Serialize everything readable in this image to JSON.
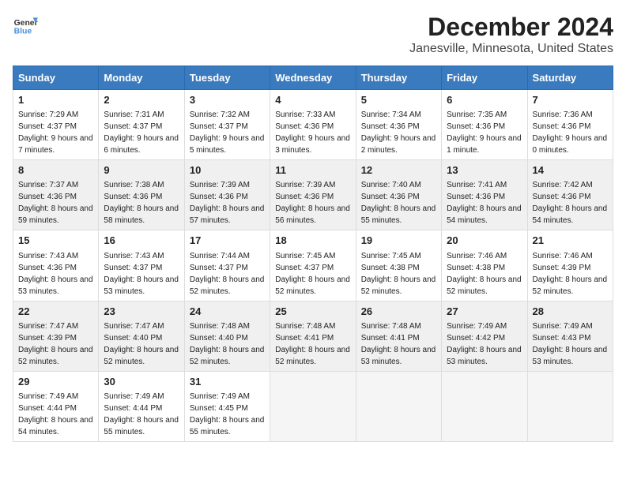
{
  "header": {
    "logo_general": "General",
    "logo_blue": "Blue",
    "title": "December 2024",
    "subtitle": "Janesville, Minnesota, United States"
  },
  "days_of_week": [
    "Sunday",
    "Monday",
    "Tuesday",
    "Wednesday",
    "Thursday",
    "Friday",
    "Saturday"
  ],
  "weeks": [
    [
      {
        "day": 1,
        "sunrise": "Sunrise: 7:29 AM",
        "sunset": "Sunset: 4:37 PM",
        "daylight": "Daylight: 9 hours and 7 minutes."
      },
      {
        "day": 2,
        "sunrise": "Sunrise: 7:31 AM",
        "sunset": "Sunset: 4:37 PM",
        "daylight": "Daylight: 9 hours and 6 minutes."
      },
      {
        "day": 3,
        "sunrise": "Sunrise: 7:32 AM",
        "sunset": "Sunset: 4:37 PM",
        "daylight": "Daylight: 9 hours and 5 minutes."
      },
      {
        "day": 4,
        "sunrise": "Sunrise: 7:33 AM",
        "sunset": "Sunset: 4:36 PM",
        "daylight": "Daylight: 9 hours and 3 minutes."
      },
      {
        "day": 5,
        "sunrise": "Sunrise: 7:34 AM",
        "sunset": "Sunset: 4:36 PM",
        "daylight": "Daylight: 9 hours and 2 minutes."
      },
      {
        "day": 6,
        "sunrise": "Sunrise: 7:35 AM",
        "sunset": "Sunset: 4:36 PM",
        "daylight": "Daylight: 9 hours and 1 minute."
      },
      {
        "day": 7,
        "sunrise": "Sunrise: 7:36 AM",
        "sunset": "Sunset: 4:36 PM",
        "daylight": "Daylight: 9 hours and 0 minutes."
      }
    ],
    [
      {
        "day": 8,
        "sunrise": "Sunrise: 7:37 AM",
        "sunset": "Sunset: 4:36 PM",
        "daylight": "Daylight: 8 hours and 59 minutes."
      },
      {
        "day": 9,
        "sunrise": "Sunrise: 7:38 AM",
        "sunset": "Sunset: 4:36 PM",
        "daylight": "Daylight: 8 hours and 58 minutes."
      },
      {
        "day": 10,
        "sunrise": "Sunrise: 7:39 AM",
        "sunset": "Sunset: 4:36 PM",
        "daylight": "Daylight: 8 hours and 57 minutes."
      },
      {
        "day": 11,
        "sunrise": "Sunrise: 7:39 AM",
        "sunset": "Sunset: 4:36 PM",
        "daylight": "Daylight: 8 hours and 56 minutes."
      },
      {
        "day": 12,
        "sunrise": "Sunrise: 7:40 AM",
        "sunset": "Sunset: 4:36 PM",
        "daylight": "Daylight: 8 hours and 55 minutes."
      },
      {
        "day": 13,
        "sunrise": "Sunrise: 7:41 AM",
        "sunset": "Sunset: 4:36 PM",
        "daylight": "Daylight: 8 hours and 54 minutes."
      },
      {
        "day": 14,
        "sunrise": "Sunrise: 7:42 AM",
        "sunset": "Sunset: 4:36 PM",
        "daylight": "Daylight: 8 hours and 54 minutes."
      }
    ],
    [
      {
        "day": 15,
        "sunrise": "Sunrise: 7:43 AM",
        "sunset": "Sunset: 4:36 PM",
        "daylight": "Daylight: 8 hours and 53 minutes."
      },
      {
        "day": 16,
        "sunrise": "Sunrise: 7:43 AM",
        "sunset": "Sunset: 4:37 PM",
        "daylight": "Daylight: 8 hours and 53 minutes."
      },
      {
        "day": 17,
        "sunrise": "Sunrise: 7:44 AM",
        "sunset": "Sunset: 4:37 PM",
        "daylight": "Daylight: 8 hours and 52 minutes."
      },
      {
        "day": 18,
        "sunrise": "Sunrise: 7:45 AM",
        "sunset": "Sunset: 4:37 PM",
        "daylight": "Daylight: 8 hours and 52 minutes."
      },
      {
        "day": 19,
        "sunrise": "Sunrise: 7:45 AM",
        "sunset": "Sunset: 4:38 PM",
        "daylight": "Daylight: 8 hours and 52 minutes."
      },
      {
        "day": 20,
        "sunrise": "Sunrise: 7:46 AM",
        "sunset": "Sunset: 4:38 PM",
        "daylight": "Daylight: 8 hours and 52 minutes."
      },
      {
        "day": 21,
        "sunrise": "Sunrise: 7:46 AM",
        "sunset": "Sunset: 4:39 PM",
        "daylight": "Daylight: 8 hours and 52 minutes."
      }
    ],
    [
      {
        "day": 22,
        "sunrise": "Sunrise: 7:47 AM",
        "sunset": "Sunset: 4:39 PM",
        "daylight": "Daylight: 8 hours and 52 minutes."
      },
      {
        "day": 23,
        "sunrise": "Sunrise: 7:47 AM",
        "sunset": "Sunset: 4:40 PM",
        "daylight": "Daylight: 8 hours and 52 minutes."
      },
      {
        "day": 24,
        "sunrise": "Sunrise: 7:48 AM",
        "sunset": "Sunset: 4:40 PM",
        "daylight": "Daylight: 8 hours and 52 minutes."
      },
      {
        "day": 25,
        "sunrise": "Sunrise: 7:48 AM",
        "sunset": "Sunset: 4:41 PM",
        "daylight": "Daylight: 8 hours and 52 minutes."
      },
      {
        "day": 26,
        "sunrise": "Sunrise: 7:48 AM",
        "sunset": "Sunset: 4:41 PM",
        "daylight": "Daylight: 8 hours and 53 minutes."
      },
      {
        "day": 27,
        "sunrise": "Sunrise: 7:49 AM",
        "sunset": "Sunset: 4:42 PM",
        "daylight": "Daylight: 8 hours and 53 minutes."
      },
      {
        "day": 28,
        "sunrise": "Sunrise: 7:49 AM",
        "sunset": "Sunset: 4:43 PM",
        "daylight": "Daylight: 8 hours and 53 minutes."
      }
    ],
    [
      {
        "day": 29,
        "sunrise": "Sunrise: 7:49 AM",
        "sunset": "Sunset: 4:44 PM",
        "daylight": "Daylight: 8 hours and 54 minutes."
      },
      {
        "day": 30,
        "sunrise": "Sunrise: 7:49 AM",
        "sunset": "Sunset: 4:44 PM",
        "daylight": "Daylight: 8 hours and 55 minutes."
      },
      {
        "day": 31,
        "sunrise": "Sunrise: 7:49 AM",
        "sunset": "Sunset: 4:45 PM",
        "daylight": "Daylight: 8 hours and 55 minutes."
      },
      null,
      null,
      null,
      null
    ]
  ]
}
